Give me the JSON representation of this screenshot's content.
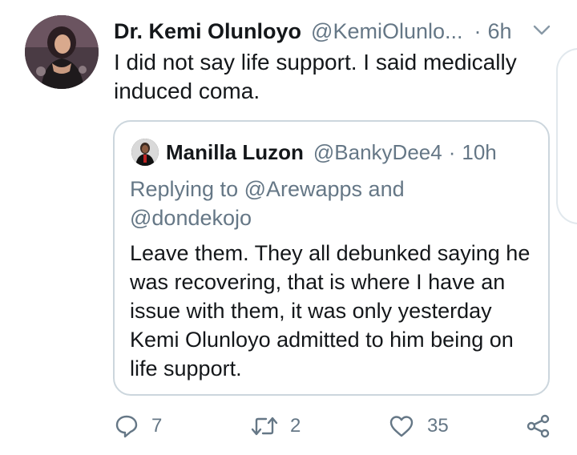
{
  "tweet": {
    "author_name": "Dr. Kemi Olunloyo",
    "handle": "@KemiOlunlo...",
    "separator": "·",
    "time": "6h",
    "text": "I did not say life support. I said medically induced coma."
  },
  "quoted": {
    "author_name": "Manilla Luzon",
    "handle": "@BankyDee4",
    "separator": "·",
    "time": "10h",
    "replying_to": "Replying to @Arewapps and @dondekojo",
    "text": "Leave them. They all debunked saying he was recovering, that is where I have an issue with them, it was only yesterday Kemi Olunloyo admitted to him being on life support."
  },
  "actions": {
    "reply_count": "7",
    "retweet_count": "2",
    "like_count": "35"
  },
  "icons": {
    "caret": "chevron-down-icon",
    "reply": "reply-icon",
    "retweet": "retweet-icon",
    "like": "heart-icon",
    "share": "share-icon"
  },
  "colors": {
    "text": "#14171a",
    "muted": "#657786",
    "border": "#ccd6dd"
  }
}
